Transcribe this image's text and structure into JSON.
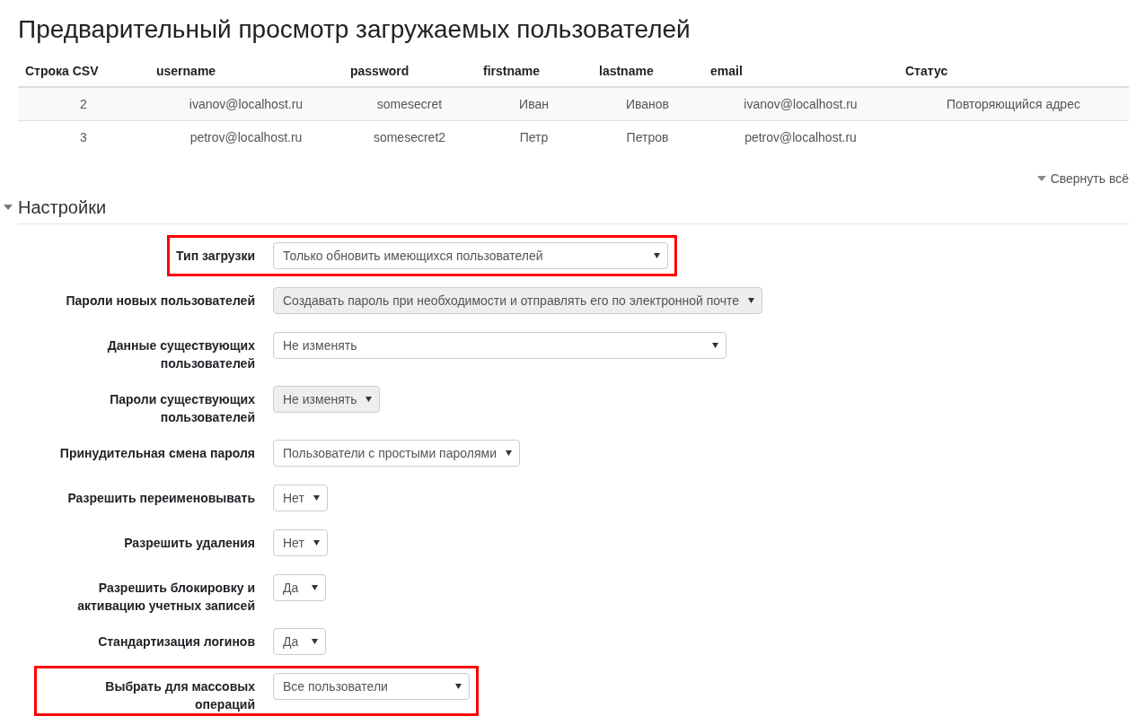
{
  "title": "Предварительный просмотр загружаемых пользователей",
  "table": {
    "columns": [
      "Строка CSV",
      "username",
      "password",
      "firstname",
      "lastname",
      "email",
      "Статус"
    ],
    "rows": [
      {
        "cells": [
          "2",
          "ivanov@localhost.ru",
          "somesecret",
          "Иван",
          "Иванов",
          "ivanov@localhost.ru",
          "Повторяющийся адрес"
        ]
      },
      {
        "cells": [
          "3",
          "petrov@localhost.ru",
          "somesecret2",
          "Петр",
          "Петров",
          "petrov@localhost.ru"
        ]
      }
    ]
  },
  "collapse_all": {
    "label": "Свернуть всё"
  },
  "section": {
    "title": "Настройки",
    "expanded": true
  },
  "settings": [
    {
      "label": "Тип загрузки",
      "value": "Только обновить имеющихся пользователей",
      "disabled": false,
      "highlighted": true
    },
    {
      "label": "Пароли новых пользователей",
      "value": "Создавать пароль при необходимости и отправлять его по электронной почте",
      "disabled": true,
      "highlighted": false
    },
    {
      "label": "Данные существующих пользователей",
      "value": "Не изменять",
      "disabled": false,
      "highlighted": false
    },
    {
      "label": "Пароли существующих пользователей",
      "value": "Не изменять",
      "disabled": true,
      "highlighted": false
    },
    {
      "label": "Принудительная смена пароля",
      "value": "Пользователи с простыми паролями",
      "disabled": false,
      "highlighted": false
    },
    {
      "label": "Разрешить переименовывать",
      "value": "Нет",
      "disabled": false,
      "highlighted": false
    },
    {
      "label": "Разрешить удаления",
      "value": "Нет",
      "disabled": false,
      "highlighted": false
    },
    {
      "label": "Разрешить блокировку и активацию учетных записей",
      "value": "Да",
      "disabled": false,
      "highlighted": false
    },
    {
      "label": "Стандартизация логинов",
      "value": "Да",
      "disabled": false,
      "highlighted": false
    },
    {
      "label": "Выбрать для массовых операций",
      "value": "Все пользователи",
      "disabled": false,
      "highlighted": true
    }
  ]
}
